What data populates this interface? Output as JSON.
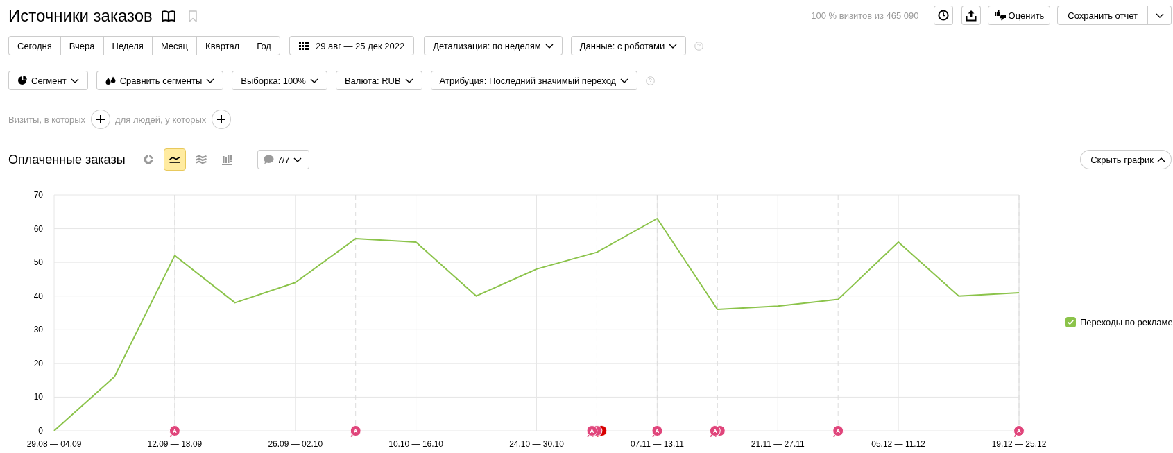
{
  "header": {
    "title": "Источники заказов",
    "bookmarked": false,
    "sample_info": "100 % визитов из 465 090",
    "rate_button": "Оценить",
    "save_button": "Сохранить отчет"
  },
  "periods": [
    {
      "label": "Сегодня",
      "selected": false
    },
    {
      "label": "Вчера",
      "selected": false
    },
    {
      "label": "Неделя",
      "selected": false
    },
    {
      "label": "Месяц",
      "selected": false
    },
    {
      "label": "Квартал",
      "selected": false
    },
    {
      "label": "Год",
      "selected": false
    }
  ],
  "date_range": "29 авг — 25 дек 2022",
  "settings": [
    {
      "label": "Детализация: по неделям"
    },
    {
      "label": "Данные: с роботами"
    }
  ],
  "filters": [
    {
      "kind": "segment",
      "label": "Сегмент"
    },
    {
      "kind": "compare",
      "label": "Сравнить сегменты"
    },
    {
      "kind": "plain",
      "label": "Выборка: 100%"
    },
    {
      "kind": "plain",
      "label": "Валюта: RUB"
    },
    {
      "kind": "plain",
      "label": "Атрибуция: Последний значимый переход"
    }
  ],
  "conditions": [
    {
      "label": "Визиты, в которых"
    },
    {
      "label": "для людей, у которых"
    }
  ],
  "chart": {
    "metric": "Оплаченные заказы",
    "view_buttons": [
      {
        "kind": "pie",
        "selected": false
      },
      {
        "kind": "line",
        "selected": true
      },
      {
        "kind": "area",
        "selected": false
      },
      {
        "kind": "bars",
        "selected": false
      }
    ],
    "comments": "7/7",
    "hide_button": "Скрыть график",
    "chart_data": {
      "type": "line",
      "categories": [
        "29.08 — 04.09",
        null,
        "12.09 — 18.09",
        null,
        "26.09 — 02.10",
        null,
        "10.10 — 16.10",
        null,
        "24.10 — 30.10",
        null,
        "07.11 — 13.11",
        null,
        "21.11 — 27.11",
        null,
        "05.12 — 11.12",
        null,
        "19.12 — 25.12"
      ],
      "series": [
        {
          "name": "Переходы по рекламе",
          "color": "#8bc34a",
          "values": [
            0,
            16,
            52,
            38,
            44,
            57,
            56,
            40,
            48,
            53,
            63,
            36,
            37,
            39,
            56,
            40,
            41
          ]
        }
      ],
      "ylim": [
        0,
        70
      ],
      "yticks": [
        0,
        10,
        20,
        30,
        40,
        50,
        60,
        70
      ],
      "grid": true
    },
    "legend": [
      {
        "checked": true
      }
    ],
    "markers": [
      {
        "text": "A",
        "color": "#e0457b"
      },
      {
        "text": "A",
        "color": "#e0457b"
      },
      {
        "text": "A",
        "color": "#e0457b",
        "stacked": [
          {
            "color": "#e0457b"
          },
          {
            "color": "#d80000"
          }
        ]
      },
      {
        "text": "A",
        "color": "#e0457b"
      },
      {
        "text": "A",
        "color": "#e0457b",
        "stacked": [
          {
            "color": "#e0457b"
          }
        ]
      },
      {
        "text": "A",
        "color": "#e0457b"
      },
      {
        "text": "A",
        "color": "#e0457b"
      }
    ]
  }
}
